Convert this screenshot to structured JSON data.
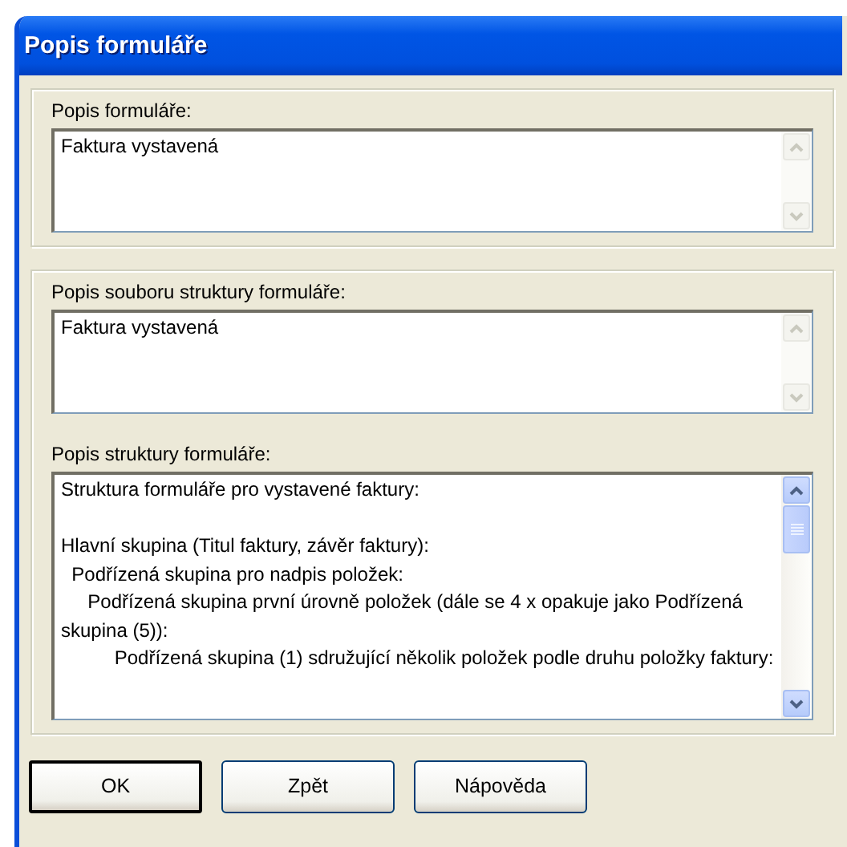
{
  "window": {
    "title": "Popis formuláře"
  },
  "groups": [
    {
      "fields": [
        {
          "label": "Popis formuláře:",
          "value": [
            "Faktura vystavená"
          ],
          "scrollable": false
        }
      ]
    },
    {
      "fields": [
        {
          "label": "Popis souboru struktury formuláře:",
          "value": [
            "Faktura vystavená"
          ],
          "scrollable": false
        },
        {
          "label": "Popis struktury formuláře:",
          "value": [
            "Struktura formuláře pro vystavené faktury:"
          ],
          "value_2": [
            "Hlavní skupina (Titul faktury, závěr faktury):",
            "  Podřízená skupina pro nadpis položek:",
            "     Podřízená skupina první úrovně položek (dále se 4 x opakuje jako Podřízená skupina (5)):",
            "          Podřízená skupina (1) sdružující několik položek podle druhu položky faktury:"
          ],
          "scrollable": true
        }
      ]
    }
  ],
  "buttons": [
    {
      "label": "OK",
      "default": true
    },
    {
      "label": "Zpět",
      "default": false
    },
    {
      "label": "Nápověda",
      "default": false
    }
  ]
}
